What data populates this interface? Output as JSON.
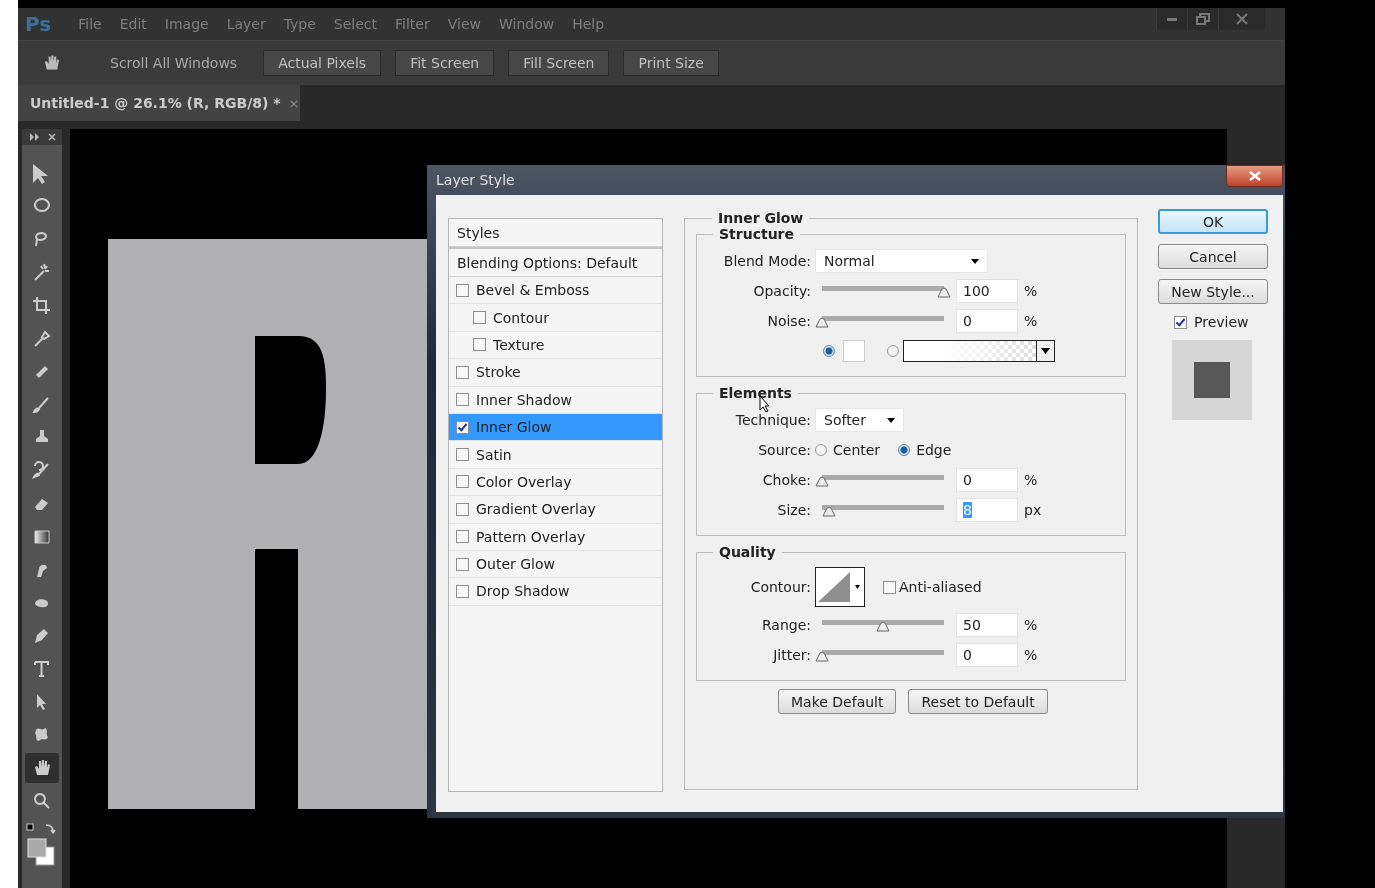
{
  "app": {
    "logo": "Ps",
    "menu": [
      "File",
      "Edit",
      "Image",
      "Layer",
      "Type",
      "Select",
      "Filter",
      "View",
      "Window",
      "Help"
    ]
  },
  "options_bar": {
    "label": "Scroll All Windows",
    "buttons": [
      "Actual Pixels",
      "Fit Screen",
      "Fill Screen",
      "Print Size"
    ]
  },
  "document_tab": {
    "title": "Untitled-1 @ 26.1% (R, RGB/8) *",
    "close": "×"
  },
  "tools": [
    {
      "kind": "move",
      "selected": false
    },
    {
      "kind": "marquee",
      "selected": false
    },
    {
      "kind": "lasso",
      "selected": false
    },
    {
      "kind": "wand",
      "selected": false
    },
    {
      "kind": "crop",
      "selected": false
    },
    {
      "kind": "eyedropper",
      "selected": false
    },
    {
      "kind": "healing",
      "selected": false
    },
    {
      "kind": "brush",
      "selected": false
    },
    {
      "kind": "stamp",
      "selected": false
    },
    {
      "kind": "history",
      "selected": false
    },
    {
      "kind": "eraser",
      "selected": false
    },
    {
      "kind": "gradient",
      "selected": false
    },
    {
      "kind": "smudge",
      "selected": false
    },
    {
      "kind": "dodge",
      "selected": false
    },
    {
      "kind": "pen",
      "selected": false
    },
    {
      "kind": "type",
      "selected": false
    },
    {
      "kind": "select",
      "selected": false
    },
    {
      "kind": "shape",
      "selected": false
    },
    {
      "kind": "hand",
      "selected": true
    },
    {
      "kind": "zoom",
      "selected": false
    }
  ],
  "dialog": {
    "title": "Layer Style",
    "styles": {
      "header": "Styles",
      "blending": "Blending Options: Default",
      "effects": [
        {
          "label": "Bevel & Emboss",
          "checked": false,
          "selected": false,
          "children": [
            {
              "label": "Contour",
              "checked": false,
              "selected": false
            },
            {
              "label": "Texture",
              "checked": false,
              "selected": false
            }
          ]
        },
        {
          "label": "Stroke",
          "checked": false,
          "selected": false
        },
        {
          "label": "Inner Shadow",
          "checked": false,
          "selected": false
        },
        {
          "label": "Inner Glow",
          "checked": true,
          "selected": true
        },
        {
          "label": "Satin",
          "checked": false,
          "selected": false
        },
        {
          "label": "Color Overlay",
          "checked": false,
          "selected": false
        },
        {
          "label": "Gradient Overlay",
          "checked": false,
          "selected": false
        },
        {
          "label": "Pattern Overlay",
          "checked": false,
          "selected": false
        },
        {
          "label": "Outer Glow",
          "checked": false,
          "selected": false
        },
        {
          "label": "Drop Shadow",
          "checked": false,
          "selected": false
        }
      ]
    },
    "panel": {
      "title": "Inner Glow",
      "sections": [
        {
          "title": "Structure",
          "rows": [
            {
              "kind": "dropdown",
              "label": "Blend Mode:",
              "value": "Normal"
            },
            {
              "kind": "slider",
              "label": "Opacity:",
              "level": 1,
              "value": "100",
              "unit": "%",
              "focused": false
            },
            {
              "kind": "slider",
              "label": "Noise:",
              "level": 0,
              "value": "0",
              "unit": "%",
              "focused": false
            },
            {
              "kind": "fill",
              "options": [
                {
                  "kind": "color",
                  "selected": true
                },
                {
                  "kind": "gradient",
                  "selected": false
                }
              ]
            }
          ]
        },
        {
          "title": "Elements",
          "rows": [
            {
              "kind": "dropdown",
              "label": "Technique:",
              "value": "Softer"
            },
            {
              "kind": "radio",
              "label": "Source:",
              "options": [
                {
                  "label": "Center",
                  "selected": false
                },
                {
                  "label": "Edge",
                  "selected": true
                }
              ]
            },
            {
              "kind": "slider",
              "label": "Choke:",
              "level": 0,
              "value": "0",
              "unit": "%",
              "focused": false
            },
            {
              "kind": "slider",
              "label": "Size:",
              "level": 0.06,
              "value": "8",
              "unit": "px",
              "focused": true
            }
          ]
        },
        {
          "title": "Quality",
          "rows": [
            {
              "kind": "contour",
              "label": "Contour:",
              "checkbox": {
                "label": "Anti-aliased",
                "checked": false
              }
            },
            {
              "kind": "slider",
              "label": "Range:",
              "level": 0.5,
              "value": "50",
              "unit": "%",
              "focused": false
            },
            {
              "kind": "slider",
              "label": "Jitter:",
              "level": 0,
              "value": "0",
              "unit": "%",
              "focused": false
            }
          ]
        }
      ],
      "buttons": [
        "Make Default",
        "Reset to Default"
      ]
    },
    "actions": [
      {
        "label": "OK",
        "default": true
      },
      {
        "label": "Cancel",
        "default": false
      },
      {
        "label": "New Style...",
        "default": false
      }
    ],
    "preview": {
      "label": "Preview",
      "checked": true
    }
  }
}
